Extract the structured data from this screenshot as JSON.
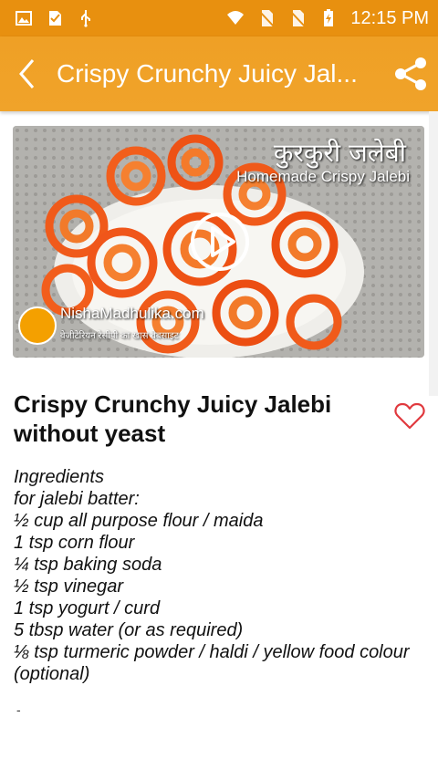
{
  "status_bar": {
    "time": "12:15 PM",
    "left_icons": [
      "image-icon",
      "check-sim-icon",
      "usb-icon"
    ],
    "right_icons": [
      "wifi-icon",
      "no-sim-icon",
      "no-sim-icon",
      "battery-charging-icon"
    ]
  },
  "app_bar": {
    "title": "Crispy Crunchy Juicy Jal...",
    "back_icon": "back-arrow-icon",
    "share_icon": "share-icon",
    "background": "#efa025"
  },
  "video": {
    "overlay_title_hi": "कुरकुरी जलेबी",
    "overlay_title_en": "Homemade Crispy Jalebi",
    "site": "NishaMadhulika.com",
    "tagline": "वेजीटेरियन रेसीपी का खास वेबसाइट",
    "play_icon": "play-icon"
  },
  "recipe": {
    "title": "Crispy Crunchy Juicy Jalebi without yeast",
    "favorite_icon": "heart-outline-icon",
    "favorite_color": "#e0393e",
    "ingredients": [
      "Ingredients",
      "for jalebi batter:",
      "½ cup all purpose flour / maida",
      "1 tsp corn flour",
      "¼ tsp baking soda",
      "½ tsp vinegar",
      "1 tsp yogurt / curd",
      "5 tbsp water (or as required)",
      "⅛ tsp turmeric powder / haldi / yellow food colour (optional)"
    ],
    "trailing": "-"
  }
}
